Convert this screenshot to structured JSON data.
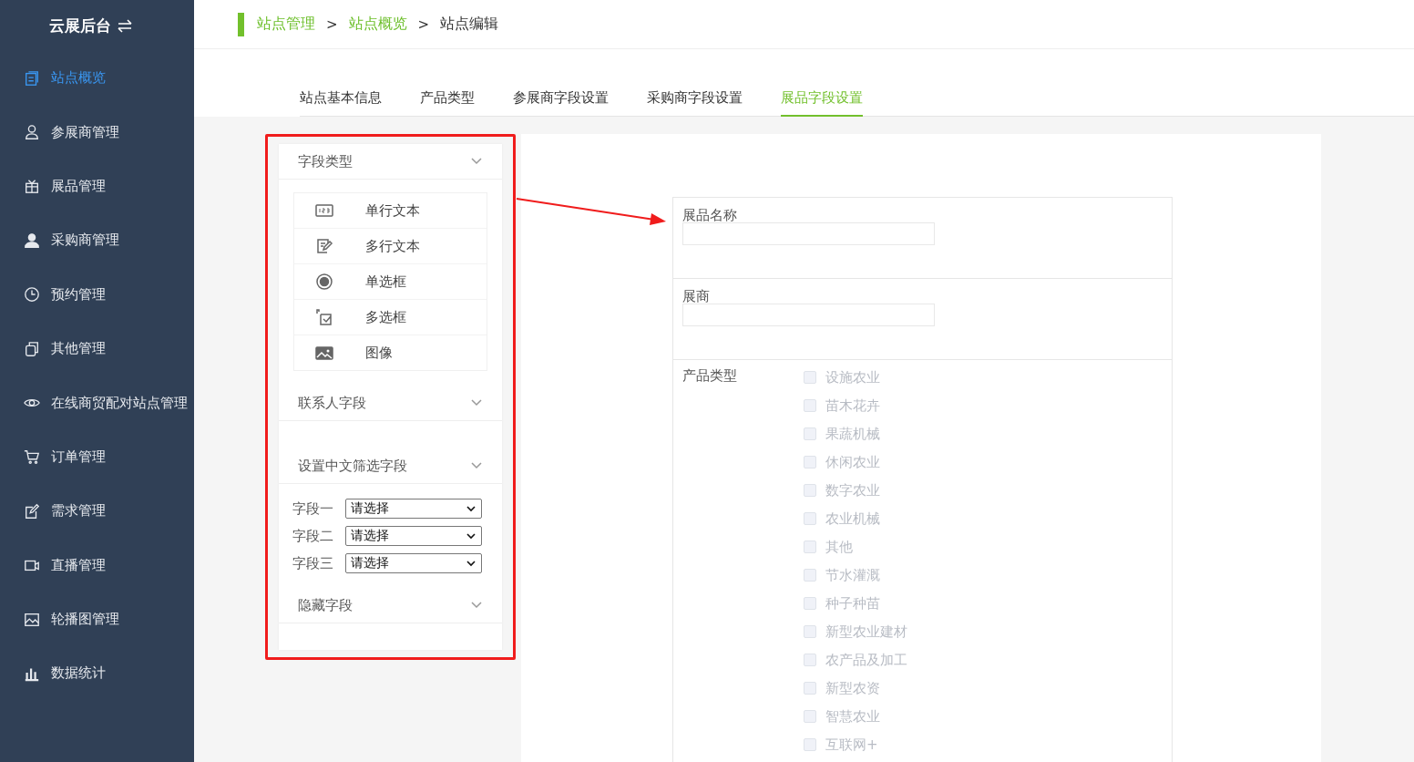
{
  "sidebar": {
    "title": "云展后台",
    "items": [
      {
        "label": "站点概览",
        "kind": "document",
        "selected": true
      },
      {
        "label": "参展商管理",
        "kind": "person-outline",
        "selected": false
      },
      {
        "label": "展品管理",
        "kind": "gift",
        "selected": false
      },
      {
        "label": "采购商管理",
        "kind": "person",
        "selected": false
      },
      {
        "label": "预约管理",
        "kind": "clock",
        "selected": false
      },
      {
        "label": "其他管理",
        "kind": "copy",
        "selected": false
      },
      {
        "label": "在线商贸配对站点管理",
        "kind": "eye",
        "selected": false
      },
      {
        "label": "订单管理",
        "kind": "cart",
        "selected": false
      },
      {
        "label": "需求管理",
        "kind": "edit",
        "selected": false
      },
      {
        "label": "直播管理",
        "kind": "video",
        "selected": false
      },
      {
        "label": "轮播图管理",
        "kind": "picture",
        "selected": false
      },
      {
        "label": "数据统计",
        "kind": "bars",
        "selected": false
      }
    ]
  },
  "breadcrumb": [
    {
      "label": "站点管理",
      "link": true
    },
    {
      "separator": ">",
      "label": "站点概览",
      "link": true
    },
    {
      "separator": ">",
      "label": "站点编辑",
      "link": false
    }
  ],
  "tabs": [
    {
      "label": "站点基本信息",
      "selected": false
    },
    {
      "label": "产品类型",
      "selected": false
    },
    {
      "label": "参展商字段设置",
      "selected": false
    },
    {
      "label": "采购商字段设置",
      "selected": false
    },
    {
      "label": "展品字段设置",
      "selected": true
    }
  ],
  "field_panel": {
    "sections": [
      {
        "title": "字段类型",
        "kind": "types",
        "items": [
          {
            "label": "单行文本",
            "kind": "text"
          },
          {
            "label": "多行文本",
            "kind": "textarea"
          },
          {
            "label": "单选框",
            "kind": "radio"
          },
          {
            "label": "多选框",
            "kind": "checkbox"
          },
          {
            "label": "图像",
            "kind": "image"
          }
        ]
      },
      {
        "title": "联系人字段",
        "kind": "empty"
      },
      {
        "title": "设置中文筛选字段",
        "kind": "filters",
        "filters": [
          {
            "label": "字段一",
            "value": "请选择"
          },
          {
            "label": "字段二",
            "value": "请选择"
          },
          {
            "label": "字段三",
            "value": "请选择"
          }
        ]
      },
      {
        "title": "隐藏字段",
        "kind": "empty"
      }
    ]
  },
  "form": {
    "fields": [
      {
        "label": "展品名称",
        "kind": "input"
      },
      {
        "label": "展商",
        "kind": "input"
      },
      {
        "label": "产品类型",
        "kind": "checkboxes",
        "options": [
          {
            "label": "设施农业",
            "checked": false,
            "disabled": true
          },
          {
            "label": "苗木花卉",
            "checked": false,
            "disabled": true
          },
          {
            "label": "果蔬机械",
            "checked": false,
            "disabled": true
          },
          {
            "label": "休闲农业",
            "checked": false,
            "disabled": true
          },
          {
            "label": "数字农业",
            "checked": false,
            "disabled": true
          },
          {
            "label": "农业机械",
            "checked": false,
            "disabled": true
          },
          {
            "label": "其他",
            "checked": false,
            "disabled": true
          },
          {
            "label": "节水灌溉",
            "checked": false,
            "disabled": true
          },
          {
            "label": "种子种苗",
            "checked": false,
            "disabled": true
          },
          {
            "label": "新型农业建材",
            "checked": false,
            "disabled": true
          },
          {
            "label": "农产品及加工",
            "checked": false,
            "disabled": true
          },
          {
            "label": "新型农资",
            "checked": false,
            "disabled": true
          },
          {
            "label": "智慧农业",
            "checked": false,
            "disabled": true
          },
          {
            "label": "互联网+",
            "checked": false,
            "disabled": true
          }
        ]
      }
    ]
  }
}
